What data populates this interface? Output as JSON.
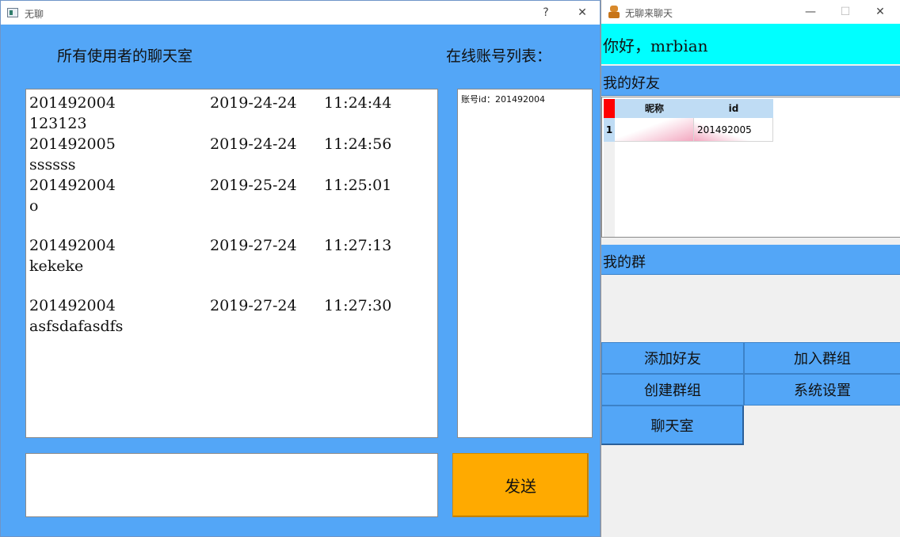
{
  "left_window": {
    "title": "无聊",
    "help_btn": "?",
    "close_btn": "✕",
    "chatroom_heading": "所有使用者的聊天室",
    "online_heading": "在线账号列表：",
    "messages": [
      {
        "user": "201492004",
        "date": "2019-24-24",
        "time": "11:24:44",
        "text": "123123"
      },
      {
        "user": "201492005",
        "date": "2019-24-24",
        "time": "11:24:56",
        "text": "ssssss"
      },
      {
        "user": "201492004",
        "date": "2019-25-24",
        "time": "11:25:01",
        "text": "o"
      },
      {
        "user": "201492004",
        "date": "2019-27-24",
        "time": "11:27:13",
        "text": "kekeke"
      },
      {
        "user": "201492004",
        "date": "2019-27-24",
        "time": "11:27:30",
        "text": "asfsdafasdfs"
      }
    ],
    "online_list": [
      "账号id：201492004"
    ],
    "send_label": "发送",
    "input_value": ""
  },
  "right_window": {
    "title": "无聊来聊天",
    "min_btn": "—",
    "max_btn": "☐",
    "close_btn": "✕",
    "greeting": "你好，mrbian",
    "friends_section": "我的好友",
    "friends_table": {
      "columns": [
        "昵称",
        "id"
      ],
      "rows": [
        {
          "index": "1",
          "nickname": "",
          "id": "201492005"
        }
      ]
    },
    "groups_section": "我的群",
    "buttons": {
      "add_friend": "添加好友",
      "join_group": "加入群组",
      "create_group": "创建群组",
      "settings": "系统设置",
      "chatroom": "聊天室"
    }
  },
  "colors": {
    "blue_bg": "#53a6f7",
    "cyan": "#00ffff",
    "send_orange": "#ffaa00",
    "table_header": "#bfdcf4"
  }
}
